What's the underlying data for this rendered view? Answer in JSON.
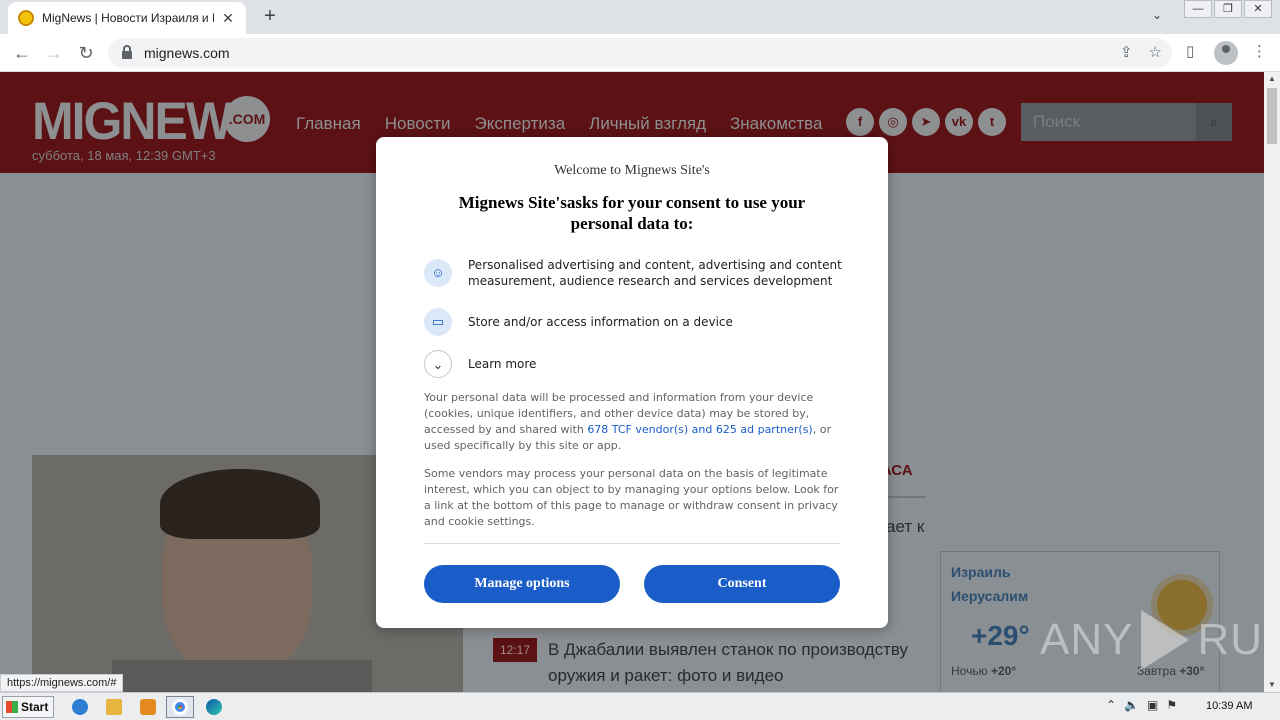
{
  "browser": {
    "tab_title": "MigNews | Новости Израиля и Мира",
    "tab_close": "✕",
    "new_tab": "+",
    "url": "mignews.com",
    "status_url": "https://mignews.com/#"
  },
  "site": {
    "logo": "MIGNEWS",
    "logo_com": ".COM",
    "date": "суббота, 18 мая, 12:39 GMT+3",
    "nav": [
      "Главная",
      "Новости",
      "Экспертиза",
      "Личный взгляд",
      "Знакомства"
    ],
    "social": [
      "f",
      "◎",
      "➤",
      "vk",
      "t"
    ],
    "search_placeholder": "Поиск",
    "section_title_fragment": "НАСА",
    "text_fragment": "ает к",
    "news": {
      "time": "12:17",
      "text": "В Джабалии выявлен станок по производству оружия и ракет: фото и видео"
    },
    "weather": {
      "country": "Израиль",
      "city": "Иерусалим",
      "temp": "+29°",
      "night_label": "Ночью",
      "night_temp": "+20°",
      "tomorrow_label": "Завтра",
      "tomorrow_temp": "+30°"
    }
  },
  "consent": {
    "welcome": "Welcome to Mignews Site's",
    "title": "Mignews Site'sasks for your consent to use your personal data to:",
    "purposes": [
      {
        "icon": "person-icon",
        "text": "Personalised advertising and content, advertising and content measurement, audience research and services development"
      },
      {
        "icon": "device-icon",
        "text": "Store and/or access information on a device"
      }
    ],
    "learn_more": "Learn more",
    "para1_before": "Your personal data will be processed and information from your device (cookies, unique identifiers, and other device data) may be stored by, accessed by and shared with ",
    "para1_link": "678 TCF vendor(s) and 625 ad partner(s)",
    "para1_after": ", or used specifically by this site or app.",
    "para2": "Some vendors may process your personal data on the basis of legitimate interest, which you can object to by managing your options below. Look for a link at the bottom of this page to manage or withdraw consent in privacy and cookie settings.",
    "manage_label": "Manage options",
    "consent_label": "Consent",
    "accent": "#1a5dc8"
  },
  "watermark": {
    "left": "ANY",
    "right": "RUN"
  },
  "taskbar": {
    "start": "Start",
    "clock": "10:39 AM"
  }
}
